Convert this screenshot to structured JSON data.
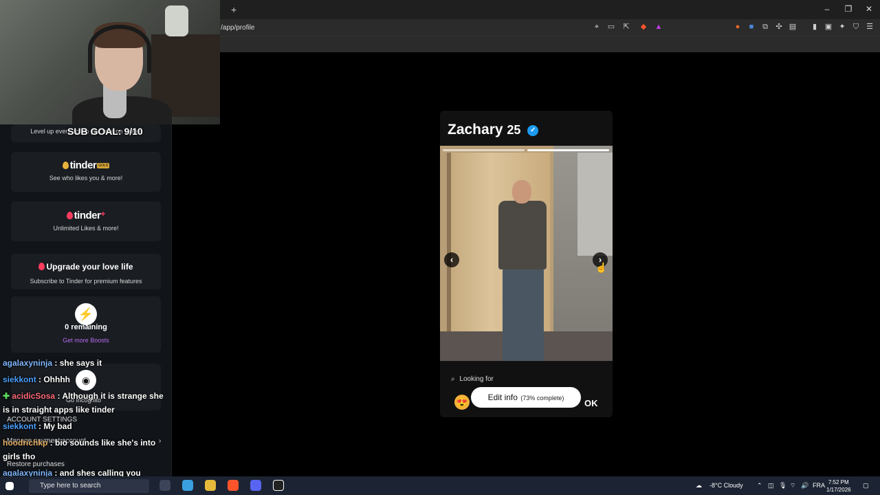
{
  "browser": {
    "url": "/app/profile",
    "new_tab": "+",
    "window_controls": [
      "minimize-icon",
      "restore-icon",
      "close-icon"
    ],
    "toolbar_icons": [
      "location-icon",
      "cast-icon",
      "share-icon",
      "brave-shield-icon",
      "rewards-icon",
      "extension-1-icon",
      "extension-2-icon",
      "extension-3-icon",
      "extensions-icon",
      "reader-icon",
      "sidebar-icon",
      "wallet-icon",
      "leo-icon",
      "vpn-icon",
      "menu-icon"
    ]
  },
  "stream": {
    "sub_goal": "SUB GOAL: 9/10"
  },
  "sidebar": {
    "level_up_text": "Level up every action you take on Tinder",
    "gold": {
      "logo": "tinder",
      "badge": "GOLD",
      "subtitle": "See who likes you & more!"
    },
    "plus": {
      "logo": "tinder",
      "plus_mark": "+",
      "subtitle": "Unlimited Likes & more!"
    },
    "upgrade": {
      "title": "Upgrade your love life",
      "subtitle": "Subscribe to Tinder for premium features"
    },
    "boosts": {
      "remaining": "0 remaining",
      "link": "Get more Boosts"
    },
    "incognito": "Go Incognito",
    "account_settings": "ACCOUNT SETTINGS",
    "manage_account": "Manage payment account",
    "restore_purchases": "Restore purchases"
  },
  "chat": [
    {
      "user": "agalaxyninja",
      "message": " : she says it",
      "color": "#7fb7ff"
    },
    {
      "user": "siekkont",
      "message": " : Ohhhh",
      "color": "#4aa0ff"
    },
    {
      "user": "acidicSosa",
      "message": " : Although it is strange she is in straight apps like tinder",
      "color": "#ff6b7a"
    },
    {
      "user": "siekkont",
      "message": " : My bad",
      "color": "#4aa0ff"
    },
    {
      "user": "hoodrichkp",
      "message": " : bio sounds like she's into girls tho",
      "color": "#e8b26a"
    },
    {
      "user": "agalaxyninja",
      "message": " : and shes calling you sweetie",
      "color": "#7fb7ff"
    }
  ],
  "profile": {
    "name": "Zachary",
    "age": "25",
    "verified_icon": "verified-badge-icon",
    "looking_for": "Looking for",
    "edit_info": "Edit info",
    "completion": "(73% complete)",
    "ok": "OK",
    "photo_count": 2,
    "active_photo": 1
  },
  "taskbar": {
    "search_placeholder": "Type here to search",
    "weather": "-8°C  Cloudy",
    "language": "FRA",
    "time": "7:52 PM",
    "date": "1/17/2026"
  }
}
